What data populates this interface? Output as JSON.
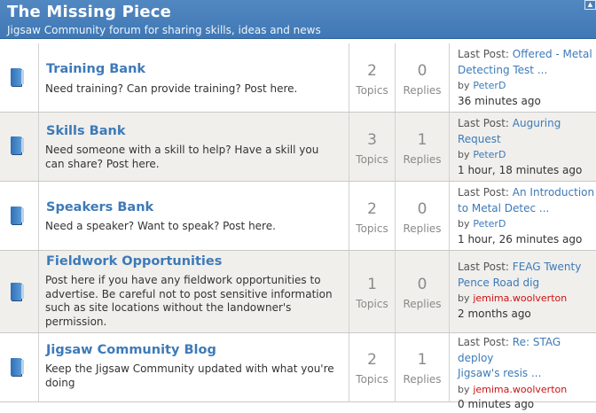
{
  "header": {
    "title": "The Missing Piece",
    "subtitle": "Jigsaw Community forum for sharing skills, ideas and news",
    "collapse_glyph": "▲"
  },
  "labels": {
    "topics": "Topics",
    "replies": "Replies",
    "last_post": "Last Post:",
    "by": "by"
  },
  "colors": {
    "header_bg": "#4a82bd",
    "link": "#3d7ab8",
    "user_red": "#cc1111",
    "row_alt": "#f0efec"
  },
  "forums": [
    {
      "title": "Training Bank",
      "description": "Need training? Can provide training? Post here.",
      "topics": "2",
      "replies": "0",
      "last_post_line1": "Offered - Metal",
      "last_post_line2": "Detecting Test ...",
      "author": "PeterD",
      "author_color": "blue",
      "time": "36 minutes ago",
      "icon": "forum-folder-icon"
    },
    {
      "title": "Skills Bank",
      "description": "Need someone with a skill to help? Have a skill you can share? Post here.",
      "topics": "3",
      "replies": "1",
      "last_post_line1": "Auguring",
      "last_post_line2": "Request",
      "author": "PeterD",
      "author_color": "blue",
      "time": "1 hour, 18 minutes ago",
      "icon": "forum-folder-icon"
    },
    {
      "title": "Speakers Bank",
      "description": "Need a speaker? Want to speak? Post here.",
      "topics": "2",
      "replies": "0",
      "last_post_line1": "An Introduction",
      "last_post_line2": "to Metal Detec ...",
      "author": "PeterD",
      "author_color": "blue",
      "time": "1 hour, 26 minutes ago",
      "icon": "forum-folder-icon"
    },
    {
      "title": "Fieldwork Opportunities",
      "description": "Post here if you have any fieldwork opportunities to advertise. Be careful not to post sensitive information such as site locations without the landowner's permission.",
      "topics": "1",
      "replies": "0",
      "last_post_line1": "FEAG Twenty",
      "last_post_line2": "Pence Road dig",
      "author": "jemima.woolverton",
      "author_color": "red",
      "time": "2 months ago",
      "icon": "forum-folder-icon"
    },
    {
      "title": "Jigsaw Community Blog",
      "description": "Keep the Jigsaw Community updated with what you're doing",
      "topics": "2",
      "replies": "1",
      "last_post_line1": "Re: STAG deploy",
      "last_post_line2": "Jigsaw's resis ...",
      "author": "jemima.woolverton",
      "author_color": "red",
      "time": "0 minutes ago",
      "icon": "forum-folder-icon"
    }
  ]
}
